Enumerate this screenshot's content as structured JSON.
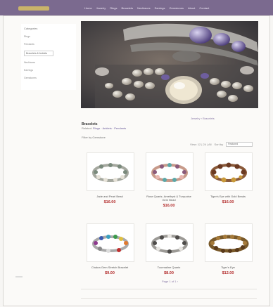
{
  "header": {
    "logo_text": "",
    "nav": [
      "Home",
      "Jewelry",
      "Rings",
      "Bracelets",
      "Necklaces",
      "Earrings",
      "Gemstones",
      "About",
      "Contact"
    ]
  },
  "sidebar": {
    "title": "Categories",
    "items": [
      "Rings",
      "Pendants",
      "Bracelets & Anklets",
      "Necklaces",
      "Earrings",
      "Gemstones"
    ]
  },
  "hero": {
    "alt": "Silver rings and gemstone jewelry display"
  },
  "breadcrumb": "Jewelry › Bracelets",
  "category": {
    "title": "Bracelets",
    "subtitle_prefix": "Related:",
    "subtitle_link": "Rings · Anklets · Pendants",
    "filter": "Filter by Gemstone"
  },
  "sort": {
    "label": "Sort by",
    "view": "View: 12 | 24 | All",
    "selected": "Featured"
  },
  "products": [
    {
      "name": "Jade and Pearl Bead",
      "price": "$16.00"
    },
    {
      "name": "Rose Quartz, Amethyst & Turquoise Gem Bead",
      "price": "$16.00"
    },
    {
      "name": "Tiger's Eye with Gold Beads",
      "price": "$16.00"
    },
    {
      "name": "Chakra Gem Stretch Bracelet",
      "price": "$9.00"
    },
    {
      "name": "Tourmaline Quartz",
      "price": "$8.00"
    },
    {
      "name": "Tiger's Eye",
      "price": "$12.00"
    }
  ],
  "pager": "Page 1 of 1  ›"
}
